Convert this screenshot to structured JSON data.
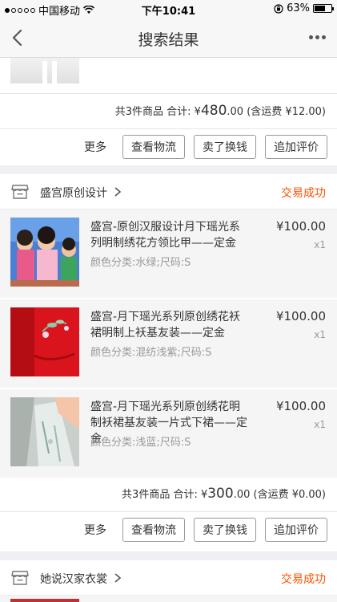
{
  "status_bar": {
    "carrier": "中国移动",
    "time": "下午10:41",
    "battery": "63%",
    "battery_level": 0.63
  },
  "nav": {
    "title": "搜索结果"
  },
  "order1": {
    "summary_prefix": "共3件商品 合计: ¥",
    "total_main": "480",
    "total_dec": ".00",
    "shipping": " (含运费 ¥12.00)"
  },
  "actions": {
    "more": "更多",
    "logistics": "查看物流",
    "resell": "卖了换钱",
    "review": "追加评价"
  },
  "order2": {
    "shop_name": "盛宫原创设计",
    "status": "交易成功",
    "items": [
      {
        "name": "盛宫-原创汉服设计月下瑶光系列明制绣花方领比甲——定金",
        "spec": "颜色分类:水绿;尺码:S",
        "price": "¥100.00",
        "qty": "x1"
      },
      {
        "name": "盛宫-月下瑶光系列原创绣花袄裙明制上袄基友装——定金",
        "spec": "颜色分类:混纺浅紫;尺码:S",
        "price": "¥100.00",
        "qty": "x1"
      },
      {
        "name": "盛宫-月下瑶光系列原创绣花明制袄裙基友装一片式下裙——定金",
        "spec": "颜色分类:浅蓝;尺码:S",
        "price": "¥100.00",
        "qty": "x1"
      }
    ],
    "summary_prefix": "共3件商品 合计: ¥",
    "total_main": "300",
    "total_dec": ".00",
    "shipping": " (含运费 ¥0.00)"
  },
  "order3": {
    "shop_name": "她说汉家衣裳",
    "status": "交易成功"
  },
  "colors": {
    "accent": "#ff5000",
    "background": "#efeff4"
  }
}
